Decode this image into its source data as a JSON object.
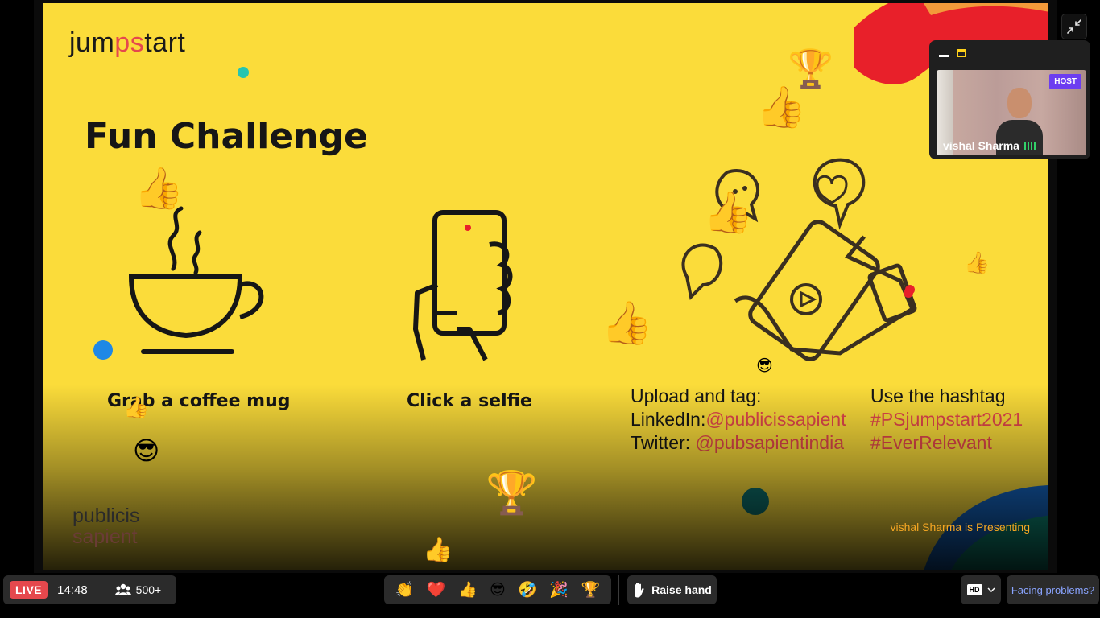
{
  "slide": {
    "logo_pre": "jum",
    "logo_ps": "ps",
    "logo_post": "tart",
    "title": "Fun Challenge",
    "captions": {
      "coffee": "Grab a coffee mug",
      "selfie": "Click a selfie"
    },
    "upload": {
      "heading": "Upload and tag:",
      "linkedin_label": "LinkedIn:",
      "linkedin_handle": "@publicissapient",
      "twitter_label": "Twitter: ",
      "twitter_handle": "@pubsapientindia"
    },
    "hashtag": {
      "heading": "Use the hashtag",
      "tag1": "#PSjumpstart2021",
      "tag2": "#EverRelevant"
    },
    "brand_line1": "publicis",
    "brand_line2": "sapient",
    "presenting": "vishal Sharma is Presenting"
  },
  "pip": {
    "host_badge": "HOST",
    "name": "vishal Sharma"
  },
  "bottom_bar": {
    "live_label": "LIVE",
    "elapsed": "14:48",
    "viewers": "500+",
    "reactions": [
      "👏",
      "❤️",
      "👍",
      "😎",
      "🤣",
      "🎉",
      "🏆"
    ],
    "raise_hand": "Raise hand",
    "quality": "HD",
    "facing_problems": "Facing problems?"
  },
  "colors": {
    "slide_bg": "#fbdc3a",
    "accent_red": "#e5484d",
    "live_red": "#e5484d",
    "host_purple": "#6c3df0",
    "presenting_orange": "#f5a623",
    "link_blue": "#8aa4ff"
  },
  "icons": {
    "shrink": "minimize-arrows-icon",
    "viewers": "people-icon",
    "raise": "hand-icon",
    "dropdown": "chevron-down-icon"
  }
}
